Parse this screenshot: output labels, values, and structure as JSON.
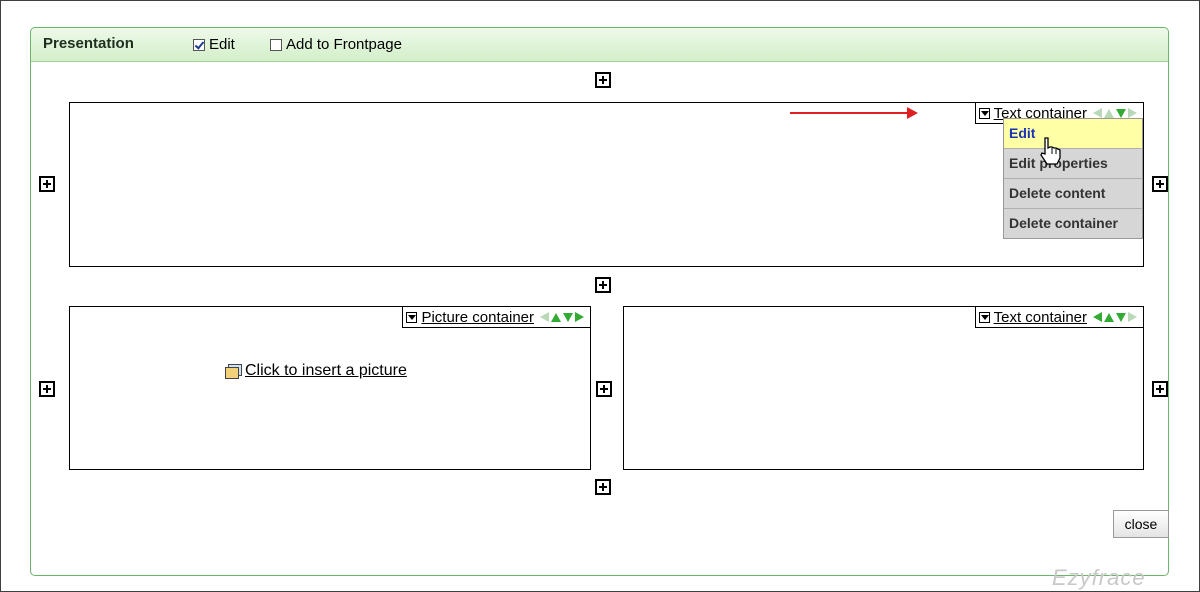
{
  "panel": {
    "title": "Presentation",
    "edit_label": "Edit",
    "frontpage_label": "Add to Frontpage"
  },
  "containers": {
    "top": {
      "label": "Text container"
    },
    "bottom_left": {
      "label": "Picture container",
      "insert_label": "Click to insert a picture"
    },
    "bottom_right": {
      "label": "Text container"
    }
  },
  "menu": {
    "items": [
      "Edit",
      "Edit properties",
      "Delete content",
      "Delete container"
    ]
  },
  "close_label": "close",
  "watermark": "Ezyfrace",
  "colors": {
    "panel_border": "#6cb36c",
    "arrow": "#e02020",
    "menu_highlight": "#ffffa6"
  }
}
